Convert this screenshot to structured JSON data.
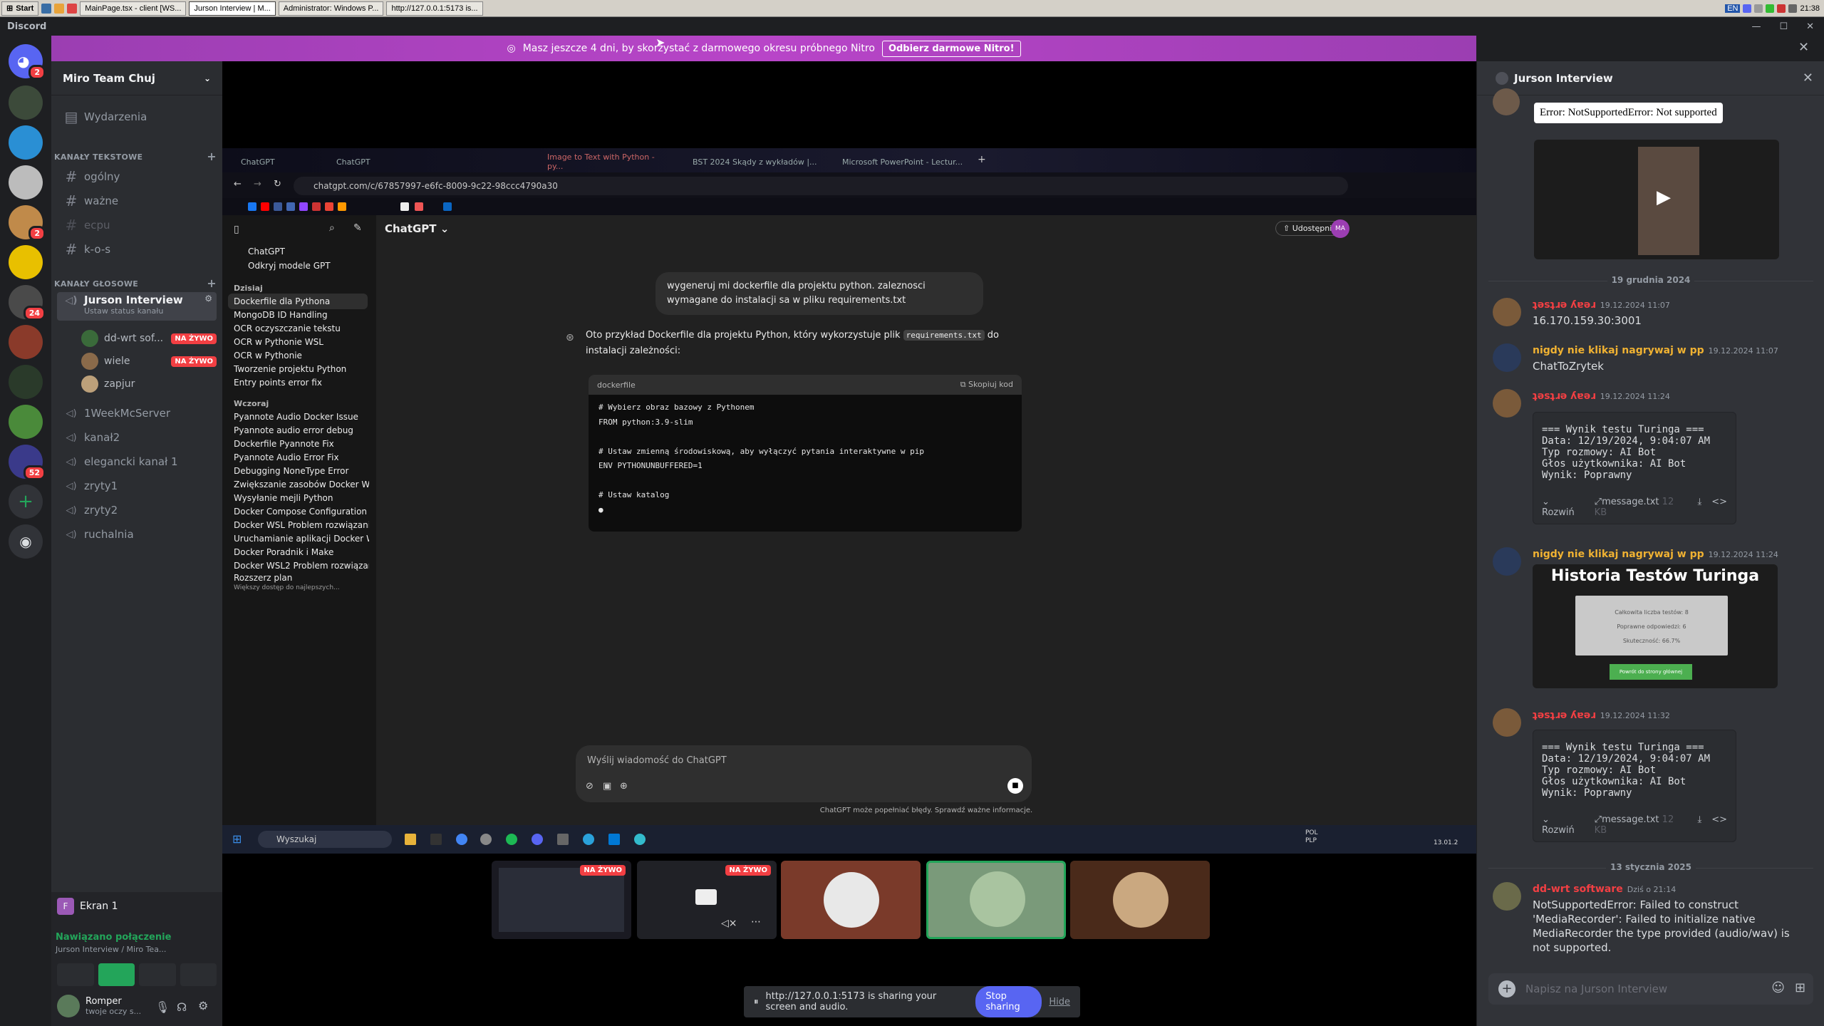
{
  "os_taskbar": {
    "start": "Start",
    "tasks": [
      "MainPage.tsx - client [WS...",
      "Jurson Interview | M...",
      "Administrator: Windows P...",
      "http://127.0.0.1:5173 is..."
    ],
    "lang": "EN",
    "time": "21:38"
  },
  "discord": {
    "app_title": "Discord",
    "nitro_banner": "Masz jeszcze 4 dni, by skorzystać z darmowego okresu próbnego Nitro",
    "nitro_button": "Odbierz darmowe Nitro!",
    "server_badges": [
      "2",
      "2",
      "24",
      "52"
    ],
    "guild_name": "Miro Team Chuj",
    "events": "Wydarzenia",
    "text_category": "KANAŁY TEKSTOWE",
    "text_channels": [
      "ogólny",
      "ważne",
      "ecpu",
      "k-o-s"
    ],
    "voice_category": "KANAŁY GŁOSOWE",
    "active_voice": "Jurson Interview",
    "set_status": "Ustaw status kanału",
    "voice_users": [
      {
        "name": "dd-wrt sof...",
        "live": "NA ŻYWO"
      },
      {
        "name": "wiele",
        "live": "NA ŻYWO"
      },
      {
        "name": "zapjur",
        "live": ""
      }
    ],
    "voice_channels": [
      "1WeekMcServer",
      "kanał2",
      "elegancki kanał 1",
      "zryty1",
      "zryty2",
      "ruchalnia"
    ],
    "screen_label": "Ekran 1",
    "connected": "Nawiązano połączenie",
    "connected_sub": "Jurson Interview / Miro Tea...",
    "user_name": "Romper",
    "user_status": "twoje oczy s..."
  },
  "shared": {
    "tabs": [
      "ChatGPT",
      "ChatGPT",
      "Image to Text with Python - py...",
      "BST 2024 Skądy z wykładów |...",
      "Microsoft PowerPoint - Lectur..."
    ],
    "url": "chatgpt.com/c/67857997-e6fc-8009-9c22-98ccc4790a30",
    "side_top": [
      "ChatGPT",
      "Odkryj modele GPT"
    ],
    "today": "Dzisiaj",
    "today_items": [
      "Dockerfile dla Pythona",
      "MongoDB ID Handling",
      "OCR oczyszczanie tekstu",
      "OCR w Pythonie WSL",
      "OCR w Pythonie",
      "Tworzenie projektu Python",
      "Entry points error fix"
    ],
    "yesterday": "Wczoraj",
    "yesterday_items": [
      "Pyannote Audio Docker Issue",
      "Pyannote audio error debug",
      "Dockerfile Pyannote Fix",
      "Pyannote Audio Error Fix",
      "Debugging NoneType Error",
      "Zwiększanie zasobów Docker WL",
      "Wysyłanie mejli Python",
      "Docker Compose Configuration",
      "Docker WSL Problem rozwiązanie",
      "Uruchamianie aplikacji Docker W",
      "Docker Poradnik i Make",
      "Docker WSL2 Problem rozwiązan"
    ],
    "upgrade": "Rozszerz plan",
    "upgrade_sub": "Większy dostęp do najlepszych...",
    "model": "ChatGPT",
    "share": "Udostępnij",
    "initials": "MA",
    "user_msg": "wygeneruj mi dockerfile dla projektu python. zaleznosci wymagane do instalacji sa w pliku requirements.txt",
    "asst_pre": "Oto przykład Dockerfile dla projektu Python, który wykorzystuje plik",
    "asst_code": "requirements.txt",
    "asst_post": "do instalacji zależności:",
    "code_lang": "dockerfile",
    "copy_code": "Skopiuj kod",
    "code_lines": [
      "# Wybierz obraz bazowy z Pythonem",
      "FROM python:3.9-slim",
      "",
      "# Ustaw zmienną środowiskową, aby wyłączyć pytania interaktywne w pip",
      "ENV PYTHONUNBUFFERED=1",
      "",
      "# Ustaw katalog"
    ],
    "composer_ph": "Wyślij wiadomość do ChatGPT",
    "disclaimer": "ChatGPT może popełniać błędy. Sprawdź ważne informacje.",
    "search": "Wyszukaj",
    "tray_lang": "POL\nPLP",
    "tray_date": "13.01.2"
  },
  "stage": {
    "live1": "NA ŻYWO",
    "live2": "NA ŻYWO",
    "share_text": "http://127.0.0.1:5173 is sharing your screen and audio.",
    "stop": "Stop sharing",
    "hide": "Hide"
  },
  "chat": {
    "title": "Jurson Interview",
    "error_box": "Error: NotSupportedError: Not supported",
    "date1": "19 grudnia 2024",
    "messages": [
      {
        "user": "ʇǝsʇɹǝ ʎɐǝɹ",
        "time": "19.12.2024 11:07",
        "text": "16.170.159.30:3001"
      },
      {
        "user": "nigdy nie klikaj nagrywaj w pp",
        "time": "19.12.2024 11:07",
        "text": "ChatToZrytek"
      },
      {
        "user": "ʇǝsʇɹǝ ʎɐǝɹ",
        "time": "19.12.2024 11:24",
        "text": ""
      },
      {
        "user": "nigdy nie klikaj nagrywaj w pp",
        "time": "19.12.2024 11:24",
        "text": ""
      },
      {
        "user": "ʇǝsʇɹǝ ʎɐǝɹ",
        "time": "19.12.2024 11:32",
        "text": ""
      }
    ],
    "attach_text": "=== Wynik testu Turinga ===\nData: 12/19/2024, 9:04:07 AM\nTyp rozmowy: AI Bot\nGłos użytkownika: AI Bot\nWynik: Poprawny",
    "expand": "Rozwiń",
    "file": "message.txt",
    "size": "12 KB",
    "history_title": "Historia Testów Turinga",
    "history_lines": [
      "Całkowita liczba testów: 8",
      "Poprawne odpowiedzi: 6",
      "Skuteczność: 66.7%"
    ],
    "history_btn": "Powrót do strony głównej",
    "date2": "13 stycznia 2025",
    "last_user": "dd-wrt software",
    "last_time": "Dziś o 21:14",
    "last_text": "NotSupportedError: Failed to construct 'MediaRecorder': Failed to initialize native MediaRecorder the type provided (audio/wav) is not supported.",
    "input_ph": "Napisz na Jurson Interview"
  },
  "colors": {
    "accent": "#5865f2",
    "nitro": "#b845c8",
    "live": "#f23f43",
    "online": "#23a55a",
    "red_name": "#f23f43",
    "yellow_name": "#f0b232"
  }
}
